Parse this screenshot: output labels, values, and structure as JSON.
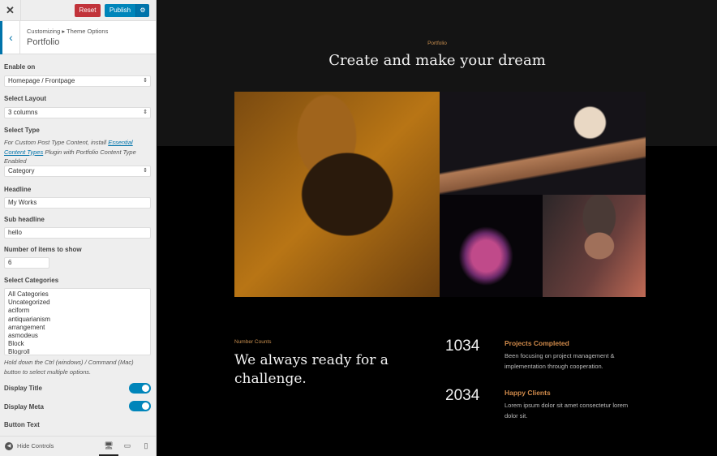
{
  "panel": {
    "close_icon": "✕",
    "reset_label": "Reset",
    "publish_label": "Publish",
    "gear_icon": "⚙",
    "back_icon": "‹",
    "breadcrumb": "Customizing ▸ Theme Options",
    "section_title": "Portfolio",
    "enable_on": {
      "label": "Enable on",
      "value": "Homepage / Frontpage"
    },
    "select_layout": {
      "label": "Select Layout",
      "value": "3 columns"
    },
    "select_type": {
      "label": "Select Type",
      "note_before": "For Custom Post Type Content, install ",
      "note_link": "Essential Content Types",
      "note_after": " Plugin with Portfolio Content Type Enabled",
      "value": "Category"
    },
    "headline": {
      "label": "Headline",
      "value": "My Works"
    },
    "sub_headline": {
      "label": "Sub headline",
      "value": "hello"
    },
    "num_items": {
      "label": "Number of items to show",
      "value": "6"
    },
    "categories": {
      "label": "Select Categories",
      "options": [
        "All Categories",
        "Uncategorized",
        "aciform",
        "antiquarianism",
        "arrangement",
        "asmodeus",
        "Block",
        "Blogroll"
      ],
      "note": "Hold down the Ctrl (windows) / Command (Mac) button to select multiple options."
    },
    "display_title": {
      "label": "Display Title",
      "enabled": true
    },
    "display_meta": {
      "label": "Display Meta",
      "enabled": true
    },
    "button_text": {
      "label": "Button Text"
    },
    "footer": {
      "hide_controls_label": "Hide Controls",
      "hide_icon": "◀",
      "devices": [
        "desktop-icon",
        "tablet-icon",
        "mobile-icon"
      ]
    }
  },
  "preview": {
    "portfolio_subtitle": "Portfolio",
    "portfolio_title": "Create and make your dream",
    "number_counts_label": "Number Counts",
    "number_counts_headline": "We always ready for a challenge.",
    "stats": [
      {
        "number": "1034",
        "title": "Projects Completed",
        "desc": "Been focusing on project management & implementation through cooperation."
      },
      {
        "number": "2034",
        "title": "Happy Clients",
        "desc": "Lorem ipsum dolor sit amet consectetur lorem dolor sit."
      }
    ]
  },
  "colors": {
    "accent": "#0085ba",
    "reset": "#c1333a",
    "gold": "#c98f4f"
  }
}
